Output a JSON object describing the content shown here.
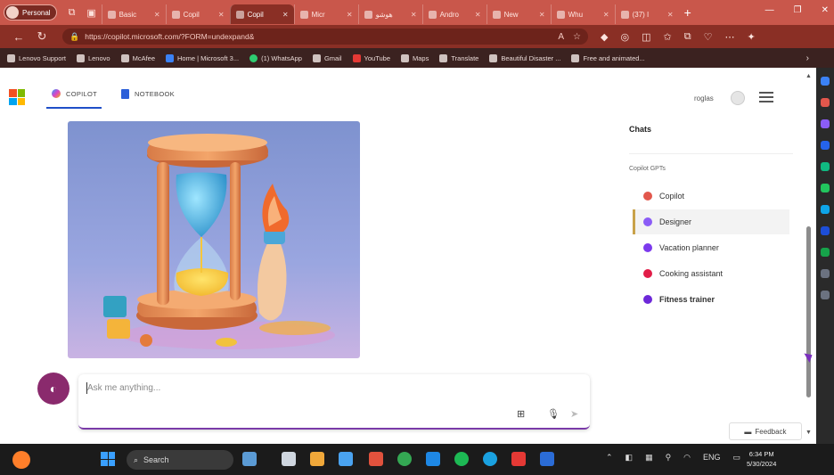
{
  "browser": {
    "profile_label": "Personal",
    "tabs": [
      {
        "label": "Basic",
        "active": false
      },
      {
        "label": "Copil",
        "active": false
      },
      {
        "label": "Copil",
        "active": true
      },
      {
        "label": "Micr",
        "active": false
      },
      {
        "label": "هوشو",
        "active": false
      },
      {
        "label": "Andro",
        "active": false
      },
      {
        "label": "New",
        "active": false
      },
      {
        "label": "Whu",
        "active": false
      },
      {
        "label": "(37) I",
        "active": false
      }
    ],
    "url": "https://copilot.microsoft.com/?FORM=undexpand&",
    "favorites": [
      {
        "label": "Lenovo Support",
        "icon": "page-icon"
      },
      {
        "label": "Lenovo",
        "icon": "page-icon"
      },
      {
        "label": "McAfee",
        "icon": "page-icon"
      },
      {
        "label": "Home | Microsoft 3...",
        "icon": "ms-icon"
      },
      {
        "label": "(1) WhatsApp",
        "icon": "whatsapp-icon"
      },
      {
        "label": "Gmail",
        "icon": "mail-icon"
      },
      {
        "label": "YouTube",
        "icon": "youtube-icon"
      },
      {
        "label": "Maps",
        "icon": "maps-icon"
      },
      {
        "label": "Translate",
        "icon": "translate-icon"
      },
      {
        "label": "Beautiful Disaster ...",
        "icon": "page-icon"
      },
      {
        "label": "Free and animated...",
        "icon": "page-icon"
      }
    ]
  },
  "header": {
    "tab_copilot": "COPILOT",
    "tab_notebook": "NOTEBOOK",
    "user_name": "roglas"
  },
  "composer": {
    "placeholder": "Ask me anything..."
  },
  "sidebar": {
    "chats_title": "Chats",
    "gpts_title": "Copilot GPTs",
    "gpts": [
      {
        "label": "Copilot",
        "color": "#e2574c",
        "active": false
      },
      {
        "label": "Designer",
        "color": "#8b5cf6",
        "active": true
      },
      {
        "label": "Vacation planner",
        "color": "#7c3aed",
        "active": false
      },
      {
        "label": "Cooking assistant",
        "color": "#e11d48",
        "active": false
      },
      {
        "label": "Fitness trainer",
        "color": "#6d28d9",
        "active": false
      }
    ]
  },
  "feedback_label": "Feedback",
  "taskbar": {
    "search_label": "Search",
    "time": "6:34 PM",
    "date": "5/30/2024",
    "language": "ENG"
  }
}
